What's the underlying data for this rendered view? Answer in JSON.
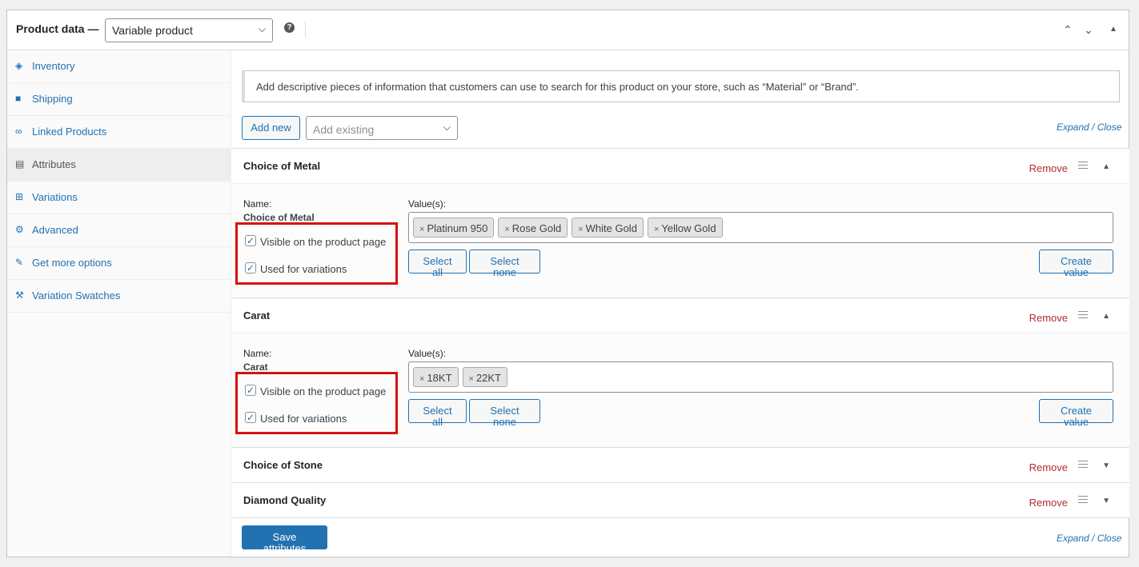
{
  "header": {
    "title": "Product data —",
    "product_type": "Variable product",
    "help_icon": "?",
    "move_up": "⌃",
    "move_down": "⌄",
    "toggle": "▲"
  },
  "tabs": [
    {
      "label": "Inventory",
      "icon": "tag-icon"
    },
    {
      "label": "Shipping",
      "icon": "truck-icon"
    },
    {
      "label": "Linked Products",
      "icon": "link-icon"
    },
    {
      "label": "Attributes",
      "icon": "list-icon"
    },
    {
      "label": "Variations",
      "icon": "grid-icon"
    },
    {
      "label": "Advanced",
      "icon": "gear-icon"
    },
    {
      "label": "Get more options",
      "icon": "plugin-icon"
    },
    {
      "label": "Variation Swatches",
      "icon": "wrench-icon"
    }
  ],
  "notice": "Add descriptive pieces of information that customers can use to search for this product on your store, such as “Material” or “Brand”.",
  "toolbar": {
    "add_new": "Add new",
    "add_existing_placeholder": "Add existing",
    "expand_close": "Expand / Close"
  },
  "attributes": [
    {
      "title": "Choice of Metal",
      "remove": "Remove",
      "name_label": "Name:",
      "name_value": "Choice of Metal",
      "values_label": "Value(s):",
      "values": [
        "Platinum 950",
        "Rose Gold",
        "White Gold",
        "Yellow Gold"
      ],
      "visible_label": "Visible on the product page",
      "variations_label": "Used for variations",
      "select_all": "Select all",
      "select_none": "Select none",
      "create_value": "Create value"
    },
    {
      "title": "Carat",
      "remove": "Remove",
      "name_label": "Name:",
      "name_value": "Carat",
      "values_label": "Value(s):",
      "values": [
        "18KT",
        "22KT"
      ],
      "visible_label": "Visible on the product page",
      "variations_label": "Used for variations",
      "select_all": "Select all",
      "select_none": "Select none",
      "create_value": "Create value"
    },
    {
      "title": "Choice of Stone",
      "remove": "Remove"
    },
    {
      "title": "Diamond Quality",
      "remove": "Remove"
    }
  ],
  "footer": {
    "save_attributes": "Save attributes",
    "expand_close": "Expand / Close"
  },
  "colors": {
    "accent": "#2271b1",
    "remove": "#b32d2e",
    "highlight": "#d90f0f"
  }
}
